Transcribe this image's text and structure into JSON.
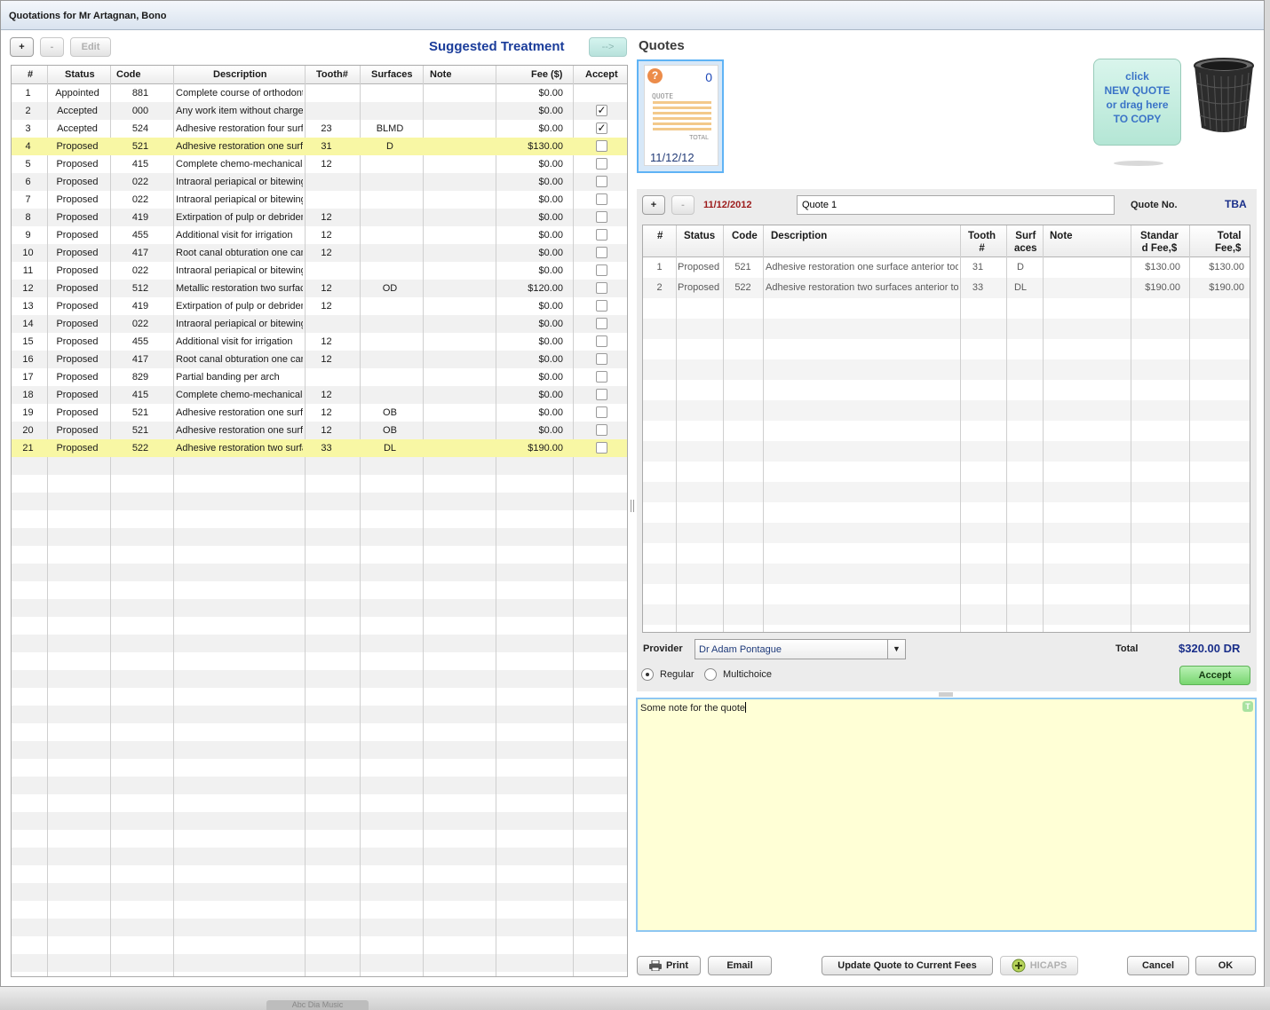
{
  "window": {
    "title": "Quotations for Mr Artagnan, Bono"
  },
  "treatment": {
    "add_label": "+",
    "remove_label": "-",
    "edit_label": "Edit",
    "title": "Suggested Treatment",
    "copy_arrow_label": "-->",
    "columns": [
      "#",
      "Status",
      "Code",
      "Description",
      "Tooth#",
      "Surfaces",
      "Note",
      "Fee ($)",
      "Accept"
    ],
    "rows": [
      {
        "num": "1",
        "status": "Appointed",
        "code": "881",
        "description": "Complete course of orthodontic treatment",
        "tooth": "",
        "surfaces": "",
        "note": "",
        "fee": "$0.00",
        "accept": null,
        "highlight": false
      },
      {
        "num": "2",
        "status": "Accepted",
        "code": "000",
        "description": "Any work item without charge",
        "tooth": "",
        "surfaces": "",
        "note": "",
        "fee": "$0.00",
        "accept": true,
        "highlight": false
      },
      {
        "num": "3",
        "status": "Accepted",
        "code": "524",
        "description": "Adhesive restoration  four surfaces",
        "tooth": "23",
        "surfaces": "BLMD",
        "note": "",
        "fee": "$0.00",
        "accept": true,
        "highlight": false
      },
      {
        "num": "4",
        "status": "Proposed",
        "code": "521",
        "description": "Adhesive restoration  one surface",
        "tooth": "31",
        "surfaces": "D",
        "note": "",
        "fee": "$130.00",
        "accept": false,
        "highlight": true
      },
      {
        "num": "5",
        "status": "Proposed",
        "code": "415",
        "description": "Complete chemo-mechanical preparation",
        "tooth": "12",
        "surfaces": "",
        "note": "",
        "fee": "$0.00",
        "accept": false,
        "highlight": false
      },
      {
        "num": "6",
        "status": "Proposed",
        "code": "022",
        "description": "Intraoral periapical or bitewing",
        "tooth": "",
        "surfaces": "",
        "note": "",
        "fee": "$0.00",
        "accept": false,
        "highlight": false
      },
      {
        "num": "7",
        "status": "Proposed",
        "code": "022",
        "description": "Intraoral periapical or bitewing",
        "tooth": "",
        "surfaces": "",
        "note": "",
        "fee": "$0.00",
        "accept": false,
        "highlight": false
      },
      {
        "num": "8",
        "status": "Proposed",
        "code": "419",
        "description": "Extirpation of pulp or debridement",
        "tooth": "12",
        "surfaces": "",
        "note": "",
        "fee": "$0.00",
        "accept": false,
        "highlight": false
      },
      {
        "num": "9",
        "status": "Proposed",
        "code": "455",
        "description": "Additional visit for irrigation",
        "tooth": "12",
        "surfaces": "",
        "note": "",
        "fee": "$0.00",
        "accept": false,
        "highlight": false
      },
      {
        "num": "10",
        "status": "Proposed",
        "code": "417",
        "description": "Root canal obturation  one canal",
        "tooth": "12",
        "surfaces": "",
        "note": "",
        "fee": "$0.00",
        "accept": false,
        "highlight": false
      },
      {
        "num": "11",
        "status": "Proposed",
        "code": "022",
        "description": "Intraoral periapical or bitewing",
        "tooth": "",
        "surfaces": "",
        "note": "",
        "fee": "$0.00",
        "accept": false,
        "highlight": false
      },
      {
        "num": "12",
        "status": "Proposed",
        "code": "512",
        "description": "Metallic restoration  two surfaces",
        "tooth": "12",
        "surfaces": "OD",
        "note": "",
        "fee": "$120.00",
        "accept": false,
        "highlight": false
      },
      {
        "num": "13",
        "status": "Proposed",
        "code": "419",
        "description": "Extirpation of pulp or debridement",
        "tooth": "12",
        "surfaces": "",
        "note": "",
        "fee": "$0.00",
        "accept": false,
        "highlight": false
      },
      {
        "num": "14",
        "status": "Proposed",
        "code": "022",
        "description": "Intraoral periapical or bitewing",
        "tooth": "",
        "surfaces": "",
        "note": "",
        "fee": "$0.00",
        "accept": false,
        "highlight": false
      },
      {
        "num": "15",
        "status": "Proposed",
        "code": "455",
        "description": "Additional visit for irrigation",
        "tooth": "12",
        "surfaces": "",
        "note": "",
        "fee": "$0.00",
        "accept": false,
        "highlight": false
      },
      {
        "num": "16",
        "status": "Proposed",
        "code": "417",
        "description": "Root canal obturation  one canal",
        "tooth": "12",
        "surfaces": "",
        "note": "",
        "fee": "$0.00",
        "accept": false,
        "highlight": false
      },
      {
        "num": "17",
        "status": "Proposed",
        "code": "829",
        "description": "Partial banding  per arch",
        "tooth": "",
        "surfaces": "",
        "note": "",
        "fee": "$0.00",
        "accept": false,
        "highlight": false
      },
      {
        "num": "18",
        "status": "Proposed",
        "code": "415",
        "description": "Complete chemo-mechanical preparation",
        "tooth": "12",
        "surfaces": "",
        "note": "",
        "fee": "$0.00",
        "accept": false,
        "highlight": false
      },
      {
        "num": "19",
        "status": "Proposed",
        "code": "521",
        "description": "Adhesive restoration  one surface",
        "tooth": "12",
        "surfaces": "OB",
        "note": "",
        "fee": "$0.00",
        "accept": false,
        "highlight": false
      },
      {
        "num": "20",
        "status": "Proposed",
        "code": "521",
        "description": "Adhesive restoration  one surface",
        "tooth": "12",
        "surfaces": "OB",
        "note": "",
        "fee": "$0.00",
        "accept": false,
        "highlight": false
      },
      {
        "num": "21",
        "status": "Proposed",
        "code": "522",
        "description": "Adhesive restoration  two surfaces",
        "tooth": "33",
        "surfaces": "DL",
        "note": "",
        "fee": "$190.00",
        "accept": false,
        "highlight": true
      }
    ]
  },
  "quotes": {
    "title": "Quotes",
    "card": {
      "help_glyph": "?",
      "count": "0",
      "label": "QUOTE",
      "total_label": "TOTAL",
      "date": "11/12/12"
    },
    "new_quote_lines": [
      "click",
      "NEW QUOTE",
      "or drag here",
      "TO COPY"
    ],
    "trash_icon": "trash-bin-icon"
  },
  "editor": {
    "add_label": "+",
    "remove_label": "-",
    "date": "11/12/2012",
    "name_value": "Quote 1",
    "quote_no_label": "Quote No.",
    "quote_no": "TBA",
    "columns": [
      "#",
      "Status",
      "Code",
      "Description",
      "Tooth\n#",
      "Surf\naces",
      "Note",
      "Standar\nd Fee,$",
      "Total\nFee,$"
    ],
    "rows": [
      {
        "num": "1",
        "status": "Proposed",
        "code": "521",
        "description": "Adhesive restoration  one surface  anterior tooth",
        "tooth": "31",
        "surfaces": "D",
        "note": "",
        "std_fee": "$130.00",
        "total_fee": "$130.00"
      },
      {
        "num": "2",
        "status": "Proposed",
        "code": "522",
        "description": "Adhesive restoration  two surfaces  anterior tooth",
        "tooth": "33",
        "surfaces": "DL",
        "note": "",
        "std_fee": "$190.00",
        "total_fee": "$190.00"
      }
    ],
    "provider_label": "Provider",
    "provider_value": "Dr Adam Pontague",
    "total_label": "Total",
    "total_value": "$320.00 DR",
    "regular_label": "Regular",
    "multichoice_label": "Multichoice",
    "accept_label": "Accept",
    "note_text": "Some note for the quote",
    "note_corner_glyph": "T"
  },
  "footer": {
    "print_label": "Print",
    "email_label": "Email",
    "update_label": "Update Quote to Current Fees",
    "hicaps_label": "HICAPS",
    "cancel_label": "Cancel",
    "ok_label": "OK"
  },
  "taskbar": {
    "ghost_label": "Abc Dia Music"
  },
  "colors": {
    "accent_blue": "#1a3c9a",
    "highlight_row": "#f8f7a4",
    "note_bg": "#ffffd6",
    "accept_green": "#78d670",
    "date_red": "#9c1b1b"
  }
}
